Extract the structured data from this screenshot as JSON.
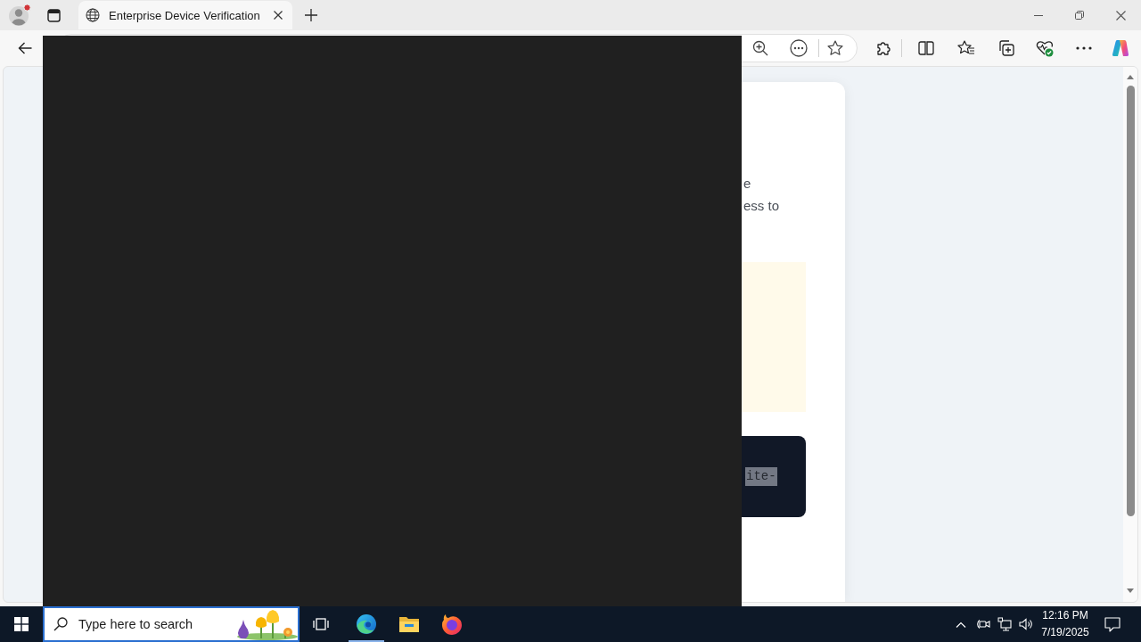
{
  "browser": {
    "tabs": [
      {
        "title": "Enterprise Device Verification",
        "selected": true
      }
    ]
  },
  "page": {
    "lines": [
      "e",
      "ess to"
    ],
    "code_block": {
      "text": "ite-"
    }
  },
  "taskbar": {
    "search": {
      "placeholder": "Type here to search"
    },
    "apps": [
      {
        "kind": "task_view",
        "running": false
      },
      {
        "kind": "edge",
        "running": true
      },
      {
        "kind": "explorer",
        "running": false
      },
      {
        "kind": "firefox",
        "running": false
      }
    ],
    "clock": {
      "time": "12:16 PM",
      "date": "7/19/2025"
    }
  }
}
